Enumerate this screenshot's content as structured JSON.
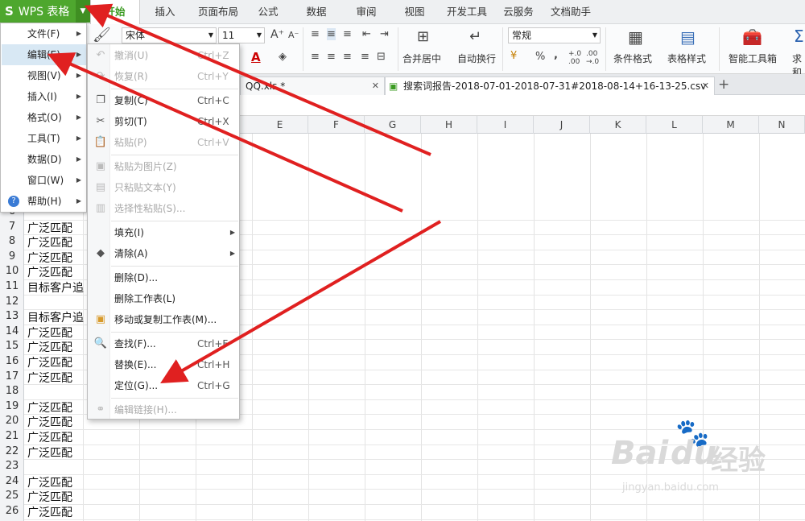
{
  "app": {
    "menu_button": "WPS 表格",
    "logo": "S"
  },
  "ribbon_tabs": [
    "开始",
    "插入",
    "页面布局",
    "公式",
    "数据",
    "审阅",
    "视图",
    "开发工具",
    "云服务",
    "文档助手"
  ],
  "ribbon": {
    "font_name": "宋体",
    "font_size": "11",
    "number_format": "常规",
    "merge_center": "合并居中",
    "wrap_text": "自动换行",
    "conditional_format": "条件格式",
    "table_style": "表格样式",
    "smart_toolbox": "智能工具箱",
    "sum_partial": "求和",
    "percent": "%",
    "thousand": ","
  },
  "doc_tabs": [
    {
      "label": "QQ.xls *",
      "close": "✕"
    },
    {
      "label": "搜索词报告-2018-07-01-2018-07-31#2018-08-14+16-13-25.csv *",
      "close": "✕"
    }
  ],
  "new_tab": "+",
  "columns": [
    "E",
    "F",
    "G",
    "H",
    "I",
    "J",
    "K",
    "L",
    "M",
    "N"
  ],
  "rows": [
    {
      "n": "6",
      "v": ""
    },
    {
      "n": "7",
      "v": "广泛匹配"
    },
    {
      "n": "8",
      "v": "广泛匹配"
    },
    {
      "n": "9",
      "v": "广泛匹配"
    },
    {
      "n": "10",
      "v": "广泛匹配"
    },
    {
      "n": "11",
      "v": "目标客户追"
    },
    {
      "n": "12",
      "v": ""
    },
    {
      "n": "13",
      "v": "目标客户追"
    },
    {
      "n": "14",
      "v": "广泛匹配"
    },
    {
      "n": "15",
      "v": "广泛匹配"
    },
    {
      "n": "16",
      "v": "广泛匹配"
    },
    {
      "n": "17",
      "v": "广泛匹配"
    },
    {
      "n": "18",
      "v": ""
    },
    {
      "n": "19",
      "v": "广泛匹配"
    },
    {
      "n": "20",
      "v": "广泛匹配"
    },
    {
      "n": "21",
      "v": "广泛匹配"
    },
    {
      "n": "22",
      "v": "广泛匹配"
    },
    {
      "n": "23",
      "v": ""
    },
    {
      "n": "24",
      "v": "广泛匹配"
    },
    {
      "n": "25",
      "v": "广泛匹配"
    },
    {
      "n": "26",
      "v": "广泛匹配"
    }
  ],
  "main_menu": [
    {
      "label": "文件(F)"
    },
    {
      "label": "编辑(E)"
    },
    {
      "label": "视图(V)"
    },
    {
      "label": "插入(I)"
    },
    {
      "label": "格式(O)"
    },
    {
      "label": "工具(T)"
    },
    {
      "label": "数据(D)"
    },
    {
      "label": "窗口(W)"
    },
    {
      "label": "帮助(H)"
    }
  ],
  "edit_menu": [
    {
      "label": "撤消(U)",
      "shortcut": "Ctrl+Z"
    },
    {
      "label": "恢复(R)",
      "shortcut": "Ctrl+Y"
    },
    {
      "label": "复制(C)",
      "shortcut": "Ctrl+C"
    },
    {
      "label": "剪切(T)",
      "shortcut": "Ctrl+X"
    },
    {
      "label": "粘贴(P)",
      "shortcut": "Ctrl+V"
    },
    {
      "label": "粘贴为图片(Z)",
      "shortcut": ""
    },
    {
      "label": "只粘贴文本(Y)",
      "shortcut": ""
    },
    {
      "label": "选择性粘贴(S)...",
      "shortcut": ""
    },
    {
      "label": "填充(I)",
      "shortcut": ""
    },
    {
      "label": "清除(A)",
      "shortcut": ""
    },
    {
      "label": "删除(D)...",
      "shortcut": ""
    },
    {
      "label": "删除工作表(L)",
      "shortcut": ""
    },
    {
      "label": "移动或复制工作表(M)...",
      "shortcut": ""
    },
    {
      "label": "查找(F)...",
      "shortcut": "Ctrl+F"
    },
    {
      "label": "替换(E)...",
      "shortcut": "Ctrl+H"
    },
    {
      "label": "定位(G)...",
      "shortcut": "Ctrl+G"
    },
    {
      "label": "编辑链接(H)...",
      "shortcut": ""
    }
  ],
  "watermark": {
    "brand": "Bai",
    "brand2": "du",
    "cn": "经验",
    "url": "jingyan.baidu.com"
  },
  "colors": {
    "wps_green": "#4ea72e",
    "annotation_red": "#e02020",
    "menu_highlight": "#d8e8f4"
  }
}
